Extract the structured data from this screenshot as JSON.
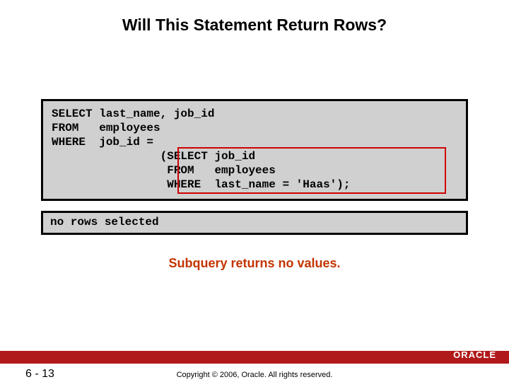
{
  "title": "Will This Statement Return Rows?",
  "code": {
    "line1": "SELECT last_name, job_id",
    "line2": "FROM   employees",
    "line3": "WHERE  job_id =",
    "line4": "                (SELECT job_id",
    "line5": "                 FROM   employees",
    "line6": "                 WHERE  last_name = 'Haas');"
  },
  "result": "no rows selected",
  "annotation": "Subquery returns no values.",
  "footer": {
    "page": "6 - 13",
    "copyright": "Copyright © 2006, Oracle. All rights reserved.",
    "logo": "ORACLE"
  }
}
